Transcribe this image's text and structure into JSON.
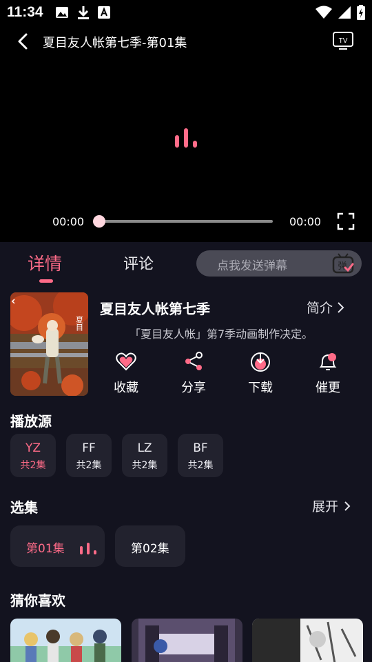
{
  "status_bar": {
    "time": "11:34"
  },
  "player": {
    "title": "夏目友人帐第七季-第01集",
    "current_time": "00:00",
    "total_time": "00:00",
    "progress": 0
  },
  "tabs": {
    "details": "详情",
    "comments": "评论"
  },
  "danmaku": {
    "placeholder": "点我发送弹幕",
    "icon_label": "弹"
  },
  "info": {
    "title": "夏目友人帐第七季",
    "intro_label": "简介",
    "description": "「夏目友人帐」第7季动画制作决定。"
  },
  "actions": [
    {
      "label": "收藏",
      "icon": "heart-icon"
    },
    {
      "label": "分享",
      "icon": "share-icon"
    },
    {
      "label": "下载",
      "icon": "download-icon"
    },
    {
      "label": "催更",
      "icon": "bell-icon"
    }
  ],
  "sources": {
    "title": "播放源",
    "items": [
      {
        "name": "YZ",
        "count": "共2集",
        "active": true
      },
      {
        "name": "FF",
        "count": "共2集",
        "active": false
      },
      {
        "name": "LZ",
        "count": "共2集",
        "active": false
      },
      {
        "name": "BF",
        "count": "共2集",
        "active": false
      }
    ]
  },
  "episodes": {
    "title": "选集",
    "expand_label": "展开",
    "items": [
      {
        "label": "第01集",
        "active": true
      },
      {
        "label": "第02集",
        "active": false
      }
    ]
  },
  "recommend": {
    "title": "猜你喜欢"
  },
  "colors": {
    "accent": "#ff6b88",
    "background": "#13131f",
    "chip": "#22222e"
  }
}
